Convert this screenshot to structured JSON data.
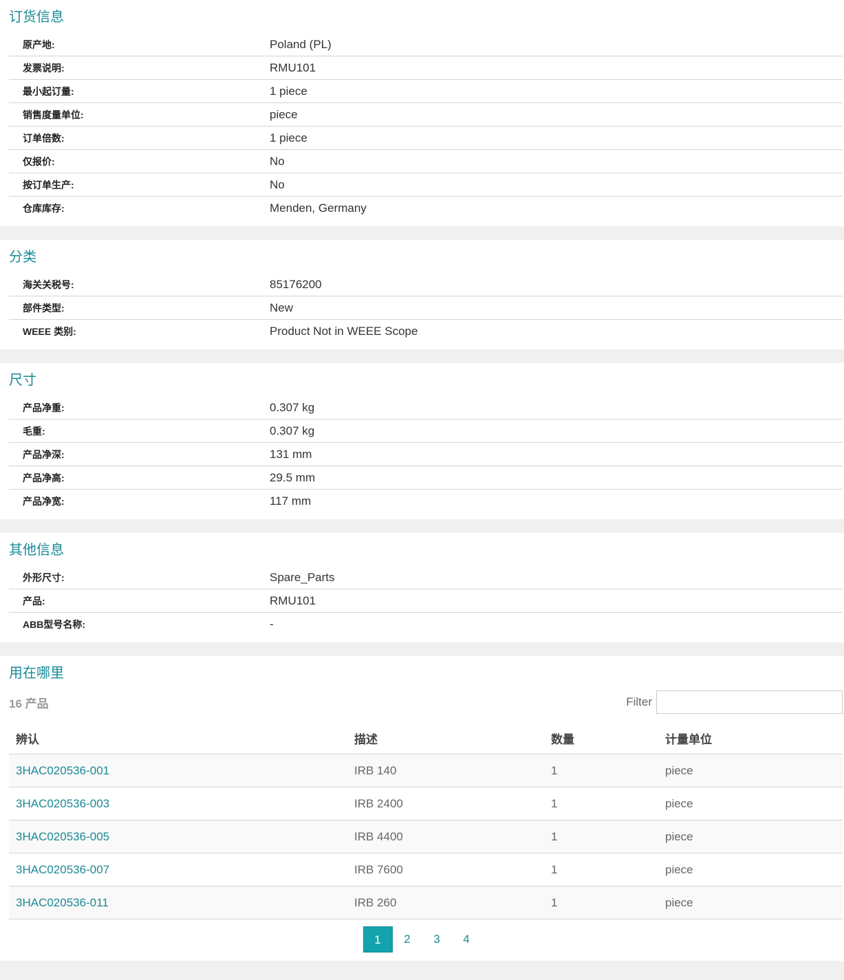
{
  "ordering": {
    "title": "订货信息",
    "rows": [
      {
        "label": "原产地:",
        "value": "Poland (PL)"
      },
      {
        "label": "发票说明:",
        "value": "RMU101"
      },
      {
        "label": "最小起订量:",
        "value": "1 piece"
      },
      {
        "label": "销售度量单位:",
        "value": "piece"
      },
      {
        "label": "订单倍数:",
        "value": "1 piece"
      },
      {
        "label": "仅报价:",
        "value": "No"
      },
      {
        "label": "按订单生产:",
        "value": "No"
      },
      {
        "label": "仓库库存:",
        "value": "Menden, Germany"
      }
    ]
  },
  "classification": {
    "title": "分类",
    "rows": [
      {
        "label": "海关关税号:",
        "value": "85176200"
      },
      {
        "label": "部件类型:",
        "value": "New"
      },
      {
        "label": "WEEE 类别:",
        "value": "Product Not in WEEE Scope"
      }
    ]
  },
  "dimensions": {
    "title": "尺寸",
    "rows": [
      {
        "label": "产品净重:",
        "value": "0.307 kg"
      },
      {
        "label": "毛重:",
        "value": "0.307 kg"
      },
      {
        "label": "产品净深:",
        "value": "131 mm"
      },
      {
        "label": "产品净高:",
        "value": "29.5 mm"
      },
      {
        "label": "产品净宽:",
        "value": "117 mm"
      }
    ]
  },
  "other": {
    "title": "其他信息",
    "rows": [
      {
        "label": "外形尺寸:",
        "value": "Spare_Parts"
      },
      {
        "label": "产品:",
        "value": "RMU101"
      },
      {
        "label": "ABB型号名称:",
        "value": "-"
      }
    ]
  },
  "where_used": {
    "title": "用在哪里",
    "count": "16 产品",
    "filter_label": "Filter",
    "filter_value": "",
    "columns": [
      "辨认",
      "描述",
      "数量",
      "计量单位"
    ],
    "rows": [
      {
        "id": "3HAC020536-001",
        "desc": "IRB 140",
        "qty": "1",
        "unit": "piece"
      },
      {
        "id": "3HAC020536-003",
        "desc": "IRB 2400",
        "qty": "1",
        "unit": "piece"
      },
      {
        "id": "3HAC020536-005",
        "desc": "IRB 4400",
        "qty": "1",
        "unit": "piece"
      },
      {
        "id": "3HAC020536-007",
        "desc": "IRB 7600",
        "qty": "1",
        "unit": "piece"
      },
      {
        "id": "3HAC020536-011",
        "desc": "IRB 260",
        "qty": "1",
        "unit": "piece"
      }
    ],
    "pages": [
      "1",
      "2",
      "3",
      "4"
    ],
    "active_page": "1"
  },
  "colors": {
    "accent": "#1a8a96",
    "active_page_bg": "#12a3ad"
  }
}
